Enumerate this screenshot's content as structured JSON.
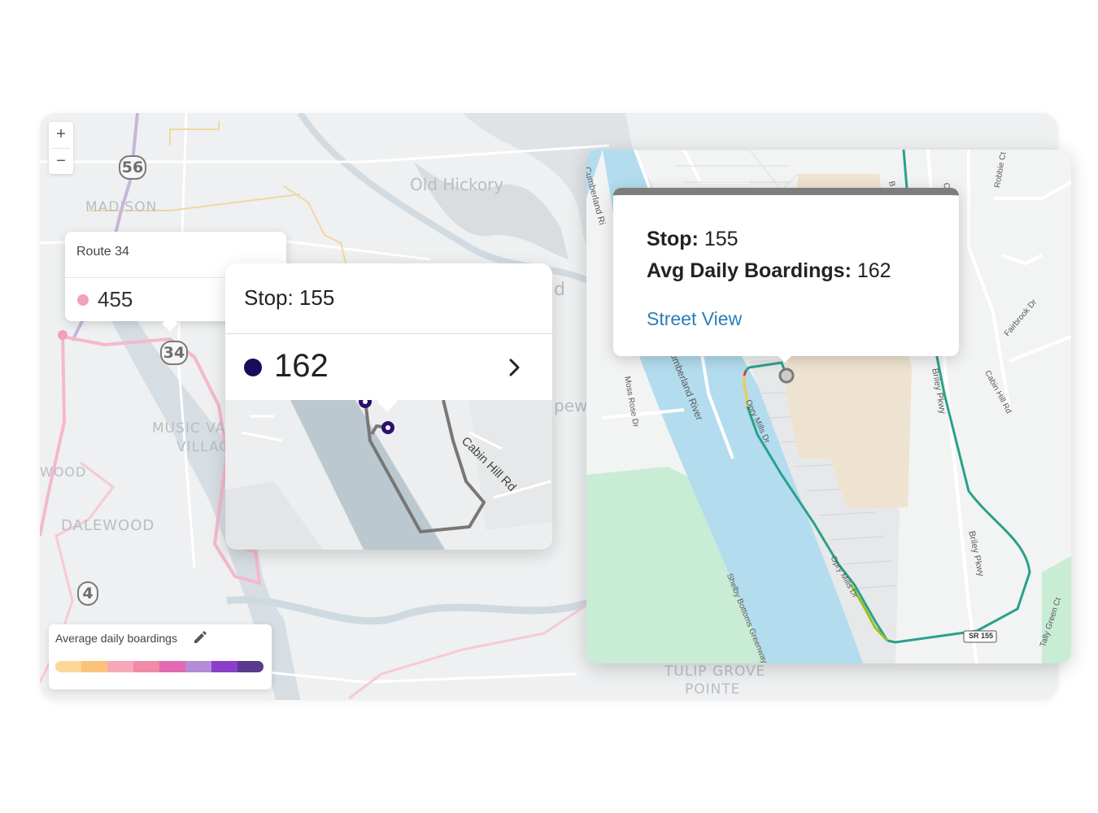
{
  "base_map": {
    "zoom_in": "+",
    "zoom_out": "−",
    "place_labels": [
      "MADISON",
      "Old Hickory",
      "MUSIC VA",
      "VILLAG",
      "WOOD",
      "DALEWOOD",
      "d",
      "pew",
      "TULIP GROVE",
      "POINTE"
    ],
    "route_shields": [
      "56",
      "34",
      "4"
    ]
  },
  "route_tooltip": {
    "title": "Route 34",
    "value": "455",
    "dot_color": "#f3a1b6"
  },
  "stop_card": {
    "title": "Stop: 155",
    "value": "162",
    "dot_color": "#1c0a5a",
    "street_label": "Cabin Hill Rd"
  },
  "detail_map": {
    "popup": {
      "stop_label": "Stop:",
      "stop_value": "155",
      "boardings_label": "Avg Daily Boardings:",
      "boardings_value": "162",
      "link": "Street View"
    },
    "street_labels": [
      "Cumberland Ri",
      "Cumberland River",
      "Moss Rose Dr",
      "Opry Mills Dr",
      "Opry Mills Dr",
      "Briley Pkwy",
      "Briley Pkwy",
      "Cabin Hill Rd",
      "Fairbrook Dr",
      "Robbie Ct",
      "Shelby Bottoms Greenway",
      "Tally Green Ct",
      "SR 155",
      "B",
      "C"
    ]
  },
  "legend": {
    "title": "Average daily boardings",
    "colors": [
      "#fdd69a",
      "#fbc37a",
      "#f7a8b8",
      "#f08aa8",
      "#e06bb0",
      "#b48bd6",
      "#8a3fc9",
      "#5a3a8c"
    ]
  }
}
